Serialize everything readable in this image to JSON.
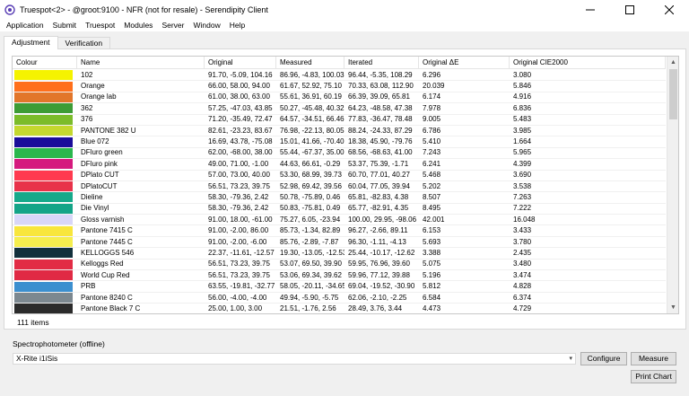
{
  "window": {
    "title": "Truespot<2> - @groot:9100 - NFR (not for resale) - Serendipity Client",
    "controls": {
      "minimize": "—",
      "maximize": "☐",
      "close": "✕"
    }
  },
  "menu": [
    "Application",
    "Submit",
    "Truespot",
    "Modules",
    "Server",
    "Window",
    "Help"
  ],
  "tabs": [
    {
      "label": "Adjustment",
      "active": true
    },
    {
      "label": "Verification",
      "active": false
    }
  ],
  "table": {
    "headers": [
      "Colour",
      "Name",
      "Original",
      "Measured",
      "Iterated",
      "Original ΔE",
      "Original CIE2000"
    ],
    "rows": [
      {
        "color": "#f5f300",
        "name": "102",
        "original": "91.70, -5.09, 104.16",
        "measured": "86.96, -4.83, 100.03",
        "iterated": "96.44, -5.35, 108.29",
        "de": "6.296",
        "cie": "3.080"
      },
      {
        "color": "#ff6f1b",
        "name": "Orange",
        "original": "66.00, 58.00, 94.00",
        "measured": "61.67, 52.92, 75.10",
        "iterated": "70.33, 63.08, 112.90",
        "de": "20.039",
        "cie": "5.846"
      },
      {
        "color": "#e2762a",
        "name": "Orange lab",
        "original": "61.00, 38.00, 63.00",
        "measured": "55.61, 36.91, 60.19",
        "iterated": "66.39, 39.09, 65.81",
        "de": "6.174",
        "cie": "4.916"
      },
      {
        "color": "#3d9c35",
        "name": "362",
        "original": "57.25, -47.03, 43.85",
        "measured": "50.27, -45.48, 40.32",
        "iterated": "64.23, -48.58, 47.38",
        "de": "7.978",
        "cie": "6.836"
      },
      {
        "color": "#7bbc2a",
        "name": "376",
        "original": "71.20, -35.49, 72.47",
        "measured": "64.57, -34.51, 66.46",
        "iterated": "77.83, -36.47, 78.48",
        "de": "9.005",
        "cie": "5.483"
      },
      {
        "color": "#c4d82e",
        "name": "PANTONE 382 U",
        "original": "82.61, -23.23, 83.67",
        "measured": "76.98, -22.13, 80.05",
        "iterated": "88.24, -24.33, 87.29",
        "de": "6.786",
        "cie": "3.985"
      },
      {
        "color": "#1a0c9a",
        "name": "Blue 072",
        "original": "16.69, 43.78, -75.08",
        "measured": "15.01, 41.66, -70.40",
        "iterated": "18.38, 45.90, -79.76",
        "de": "5.410",
        "cie": "1.664"
      },
      {
        "color": "#2ab74d",
        "name": "DFluro green",
        "original": "62.00, -68.00, 38.00",
        "measured": "55.44, -67.37, 35.00",
        "iterated": "68.56, -68.63, 41.00",
        "de": "7.243",
        "cie": "5.965"
      },
      {
        "color": "#d51a7e",
        "name": "DFluro pink",
        "original": "49.00, 71.00, -1.00",
        "measured": "44.63, 66.61, -0.29",
        "iterated": "53.37, 75.39, -1.71",
        "de": "6.241",
        "cie": "4.399"
      },
      {
        "color": "#ff3a4f",
        "name": "DPlato CUT",
        "original": "57.00, 73.00, 40.00",
        "measured": "53.30, 68.99, 39.73",
        "iterated": "60.70, 77.01, 40.27",
        "de": "5.468",
        "cie": "3.690"
      },
      {
        "color": "#e8324a",
        "name": "DPlatoCUT",
        "original": "56.51, 73.23, 39.75",
        "measured": "52.98, 69.42, 39.56",
        "iterated": "60.04, 77.05, 39.94",
        "de": "5.202",
        "cie": "3.538"
      },
      {
        "color": "#16a98a",
        "name": "Dieline",
        "original": "58.30, -79.36, 2.42",
        "measured": "50.78, -75.89, 0.46",
        "iterated": "65.81, -82.83, 4.38",
        "de": "8.507",
        "cie": "7.263"
      },
      {
        "color": "#14a487",
        "name": "Die Vinyl",
        "original": "58.30, -79.36, 2.42",
        "measured": "50.83, -75.81, 0.49",
        "iterated": "65.77, -82.91, 4.35",
        "de": "8.495",
        "cie": "7.222"
      },
      {
        "color": "#d8d6f8",
        "name": "Gloss varnish",
        "original": "91.00, 18.00, -61.00",
        "measured": "75.27, 6.05, -23.94",
        "iterated": "100.00, 29.95, -98.06",
        "de": "42.001",
        "cie": "16.048"
      },
      {
        "color": "#f8e63c",
        "name": "Pantone 7415 C",
        "original": "91.00, -2.00, 86.00",
        "measured": "85.73, -1.34, 82.89",
        "iterated": "96.27, -2.66, 89.11",
        "de": "6.153",
        "cie": "3.433"
      },
      {
        "color": "#f5ee4e",
        "name": "Pantone 7445 C",
        "original": "91.00, -2.00, -6.00",
        "measured": "85.76, -2.89, -7.87",
        "iterated": "96.30, -1.11, -4.13",
        "de": "5.693",
        "cie": "3.780"
      },
      {
        "color": "#12303c",
        "name": "KELLOGGS 546",
        "original": "22.37, -11.61, -12.57",
        "measured": "19.30, -13.05, -12.53",
        "iterated": "25.44, -10.17, -12.62",
        "de": "3.388",
        "cie": "2.435"
      },
      {
        "color": "#e22c45",
        "name": "Kelloggs Red",
        "original": "56.51, 73.23, 39.75",
        "measured": "53.07, 69.50, 39.90",
        "iterated": "59.95, 76.96, 39.60",
        "de": "5.075",
        "cie": "3.480"
      },
      {
        "color": "#e02a44",
        "name": "World Cup Red",
        "original": "56.51, 73.23, 39.75",
        "measured": "53.06, 69.34, 39.62",
        "iterated": "59.96, 77.12, 39.88",
        "de": "5.196",
        "cie": "3.474"
      },
      {
        "color": "#3c8fcf",
        "name": "PRB",
        "original": "63.55, -19.81, -32.77",
        "measured": "58.05, -20.11, -34.65",
        "iterated": "69.04, -19.52, -30.90",
        "de": "5.812",
        "cie": "4.828"
      },
      {
        "color": "#7c8890",
        "name": "Pantone 8240 C",
        "original": "56.00, -4.00, -4.00",
        "measured": "49.94, -5.90, -5.75",
        "iterated": "62.06, -2.10, -2.25",
        "de": "6.584",
        "cie": "6.374"
      },
      {
        "color": "#2b2b2b",
        "name": "Pantone Black 7 C",
        "original": "25.00, 1.00, 3.00",
        "measured": "21.51, -1.76, 2.56",
        "iterated": "28.49, 3.76, 3.44",
        "de": "4.473",
        "cie": "4.729"
      }
    ],
    "item_count": "111 items"
  },
  "spectrophotometer": {
    "label": "Spectrophotometer (offline)",
    "selected": "X-Rite i1iSis"
  },
  "buttons": {
    "configure": "Configure",
    "measure": "Measure",
    "print_chart": "Print Chart"
  }
}
